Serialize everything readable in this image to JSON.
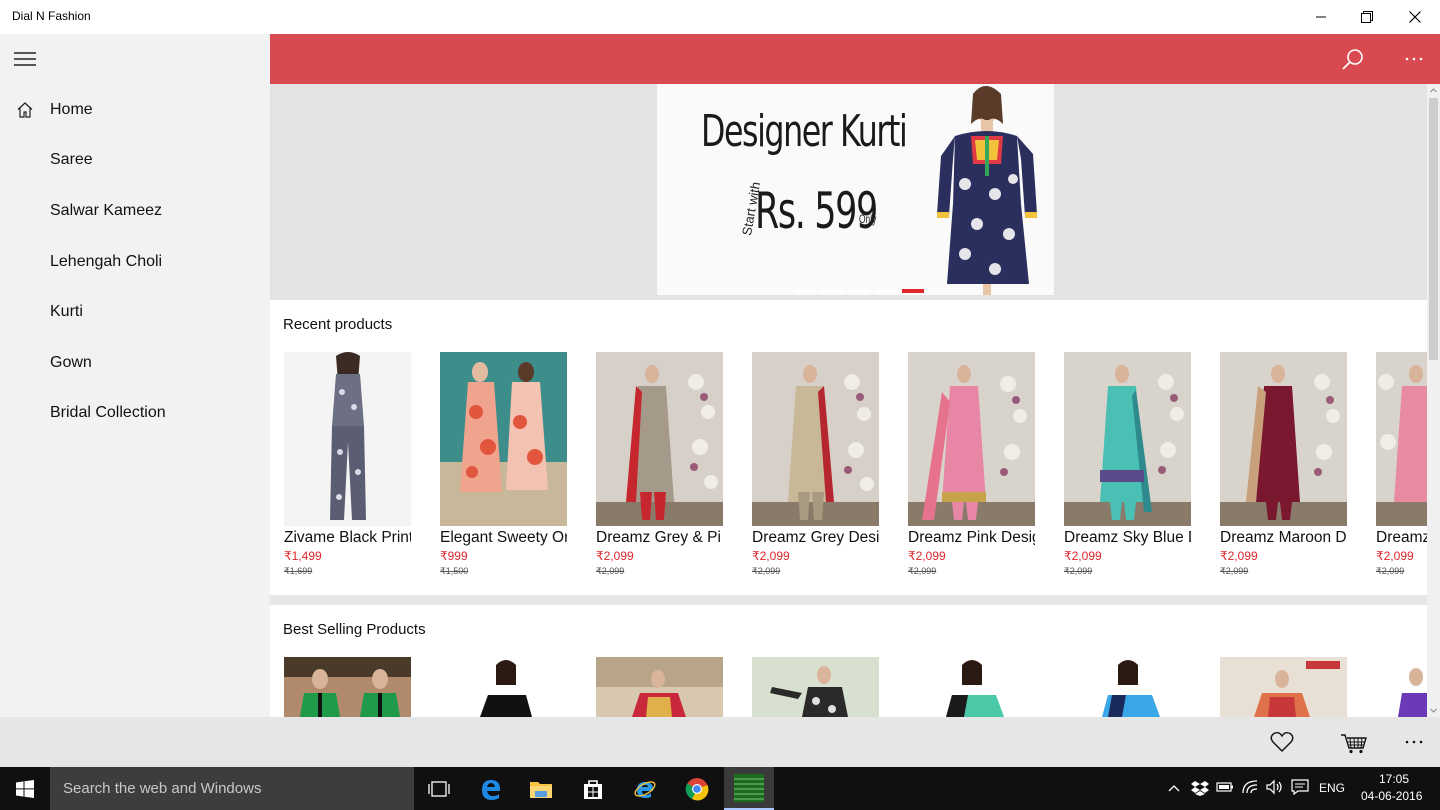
{
  "window": {
    "title": "Dial N Fashion"
  },
  "sidebar": {
    "items": [
      {
        "label": "Home",
        "icon": "home-icon"
      },
      {
        "label": "Saree"
      },
      {
        "label": "Salwar Kameez"
      },
      {
        "label": "Lehengah Choli"
      },
      {
        "label": "Kurti"
      },
      {
        "label": "Gown"
      },
      {
        "label": "Bridal Collection"
      }
    ]
  },
  "colors": {
    "accent": "#d94a50",
    "price": "#e0262b",
    "sidebar_bg": "#f2f2f2",
    "taskbar": "#101010"
  },
  "banner": {
    "headline": "Designer Kurti",
    "start_with": "Start with",
    "price": "Rs. 599",
    "only": "Only",
    "slide_count": 5,
    "active_slide": 5
  },
  "recent": {
    "title": "Recent products",
    "products": [
      {
        "name": "Zivame Black Print",
        "price": "₹1,499",
        "old_price": "₹1,699"
      },
      {
        "name": "Elegant Sweety Or",
        "price": "₹999",
        "old_price": "₹1,500"
      },
      {
        "name": "Dreamz Grey & Pi",
        "price": "₹2,099",
        "old_price": "₹2,099"
      },
      {
        "name": "Dreamz Grey Desi",
        "price": "₹2,099",
        "old_price": "₹2,099"
      },
      {
        "name": "Dreamz Pink Desig",
        "price": "₹2,099",
        "old_price": "₹2,099"
      },
      {
        "name": "Dreamz Sky Blue D",
        "price": "₹2,099",
        "old_price": "₹2,099"
      },
      {
        "name": "Dreamz Maroon D",
        "price": "₹2,099",
        "old_price": "₹2,099"
      },
      {
        "name": "Dreamz",
        "price": "₹2,099",
        "old_price": "₹2,099"
      }
    ]
  },
  "best_selling": {
    "title": "Best Selling Products"
  },
  "taskbar": {
    "search_placeholder": "Search the web and Windows",
    "language": "ENG",
    "time": "17:05",
    "date": "04-06-2016"
  }
}
